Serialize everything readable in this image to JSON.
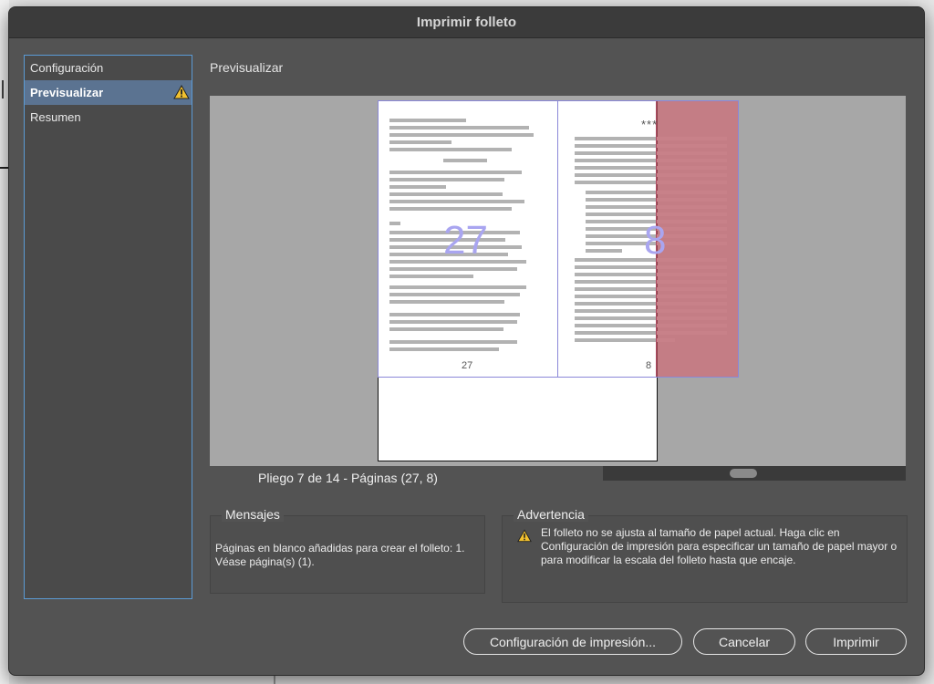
{
  "dialog": {
    "title": "Imprimir folleto"
  },
  "sidebar": {
    "items": [
      {
        "label": "Configuración",
        "active": false
      },
      {
        "label": "Previsualizar",
        "active": true,
        "warning": true
      },
      {
        "label": "Resumen",
        "active": false
      }
    ]
  },
  "main": {
    "section_title": "Previsualizar",
    "preview": {
      "left_page_number": "27",
      "right_page_number": "8",
      "left_folio": "27",
      "right_folio": "8",
      "ornament": "***"
    },
    "spread_info": "Pliego 7 de 14 - Páginas (27, 8)"
  },
  "messages": {
    "label": "Mensajes",
    "text": "Páginas en blanco añadidas para crear el folleto: 1. Véase página(s) (1)."
  },
  "warning": {
    "label": "Advertencia",
    "text": "El folleto no se ajusta al tamaño de papel actual. Haga clic en Configuración de impresión para especificar un tamaño de papel mayor o para modificar la escala del folleto hasta que encaje."
  },
  "buttons": {
    "print_setup": "Configuración de impresión...",
    "cancel": "Cancelar",
    "print": "Imprimir"
  },
  "colors": {
    "dialog_bg": "#535353",
    "sidebar_active": "#5b7391",
    "sidebar_border": "#5b9bd5",
    "overflow_red": "#d7606e",
    "page_frame": "#8a87d8",
    "warning_yellow": "#f2c12e"
  },
  "icons": {
    "warning": "warning-triangle-icon"
  }
}
